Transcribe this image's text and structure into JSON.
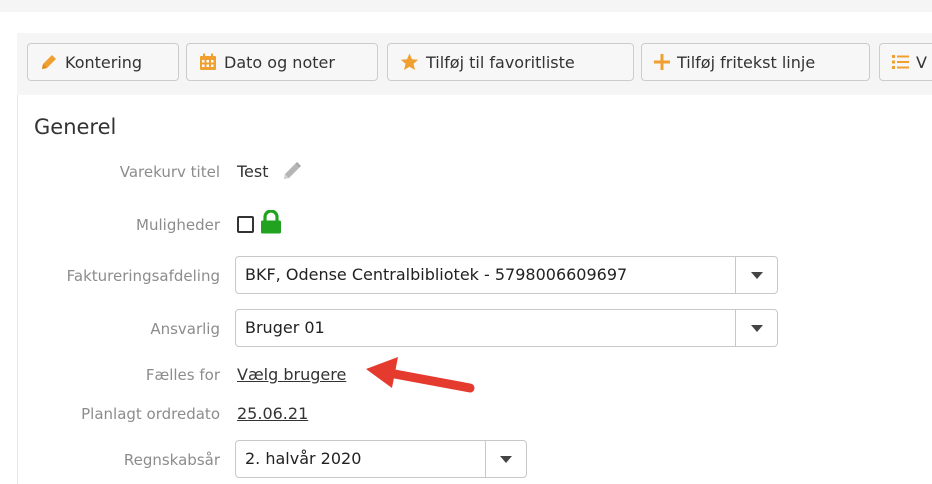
{
  "toolbar": {
    "kontering": "Kontering",
    "dato_noter": "Dato og noter",
    "favoritliste": "Tilføj til favoritliste",
    "fritekst": "Tilføj fritekst linje",
    "truncated": "V"
  },
  "section": {
    "title": "Generel",
    "varekurv_label": "Varekurv titel",
    "varekurv_value": "Test",
    "muligheder_label": "Muligheder",
    "fakturering_label": "Faktureringsafdeling",
    "fakturering_value": "BKF, Odense Centralbibliotek - 5798006609697",
    "ansvarlig_label": "Ansvarlig",
    "ansvarlig_value": "Bruger 01",
    "faelles_label": "Fælles for",
    "faelles_link": "Vælg brugere",
    "planlagt_label": "Planlagt ordredato",
    "planlagt_value": "25.06.21",
    "regnskab_label": "Regnskabsår",
    "regnskab_value": "2. halvår 2020"
  },
  "colors": {
    "pencil": "#f0a030",
    "calendar": "#f0a030",
    "star": "#f0a030",
    "plus": "#f0a030",
    "list": "#f0a030",
    "lock": "#21a321",
    "arrow": "#e53a2e"
  },
  "icons": [
    "pencil-icon",
    "calendar-icon",
    "star-icon",
    "plus-icon",
    "list-icon",
    "edit-pencil-icon",
    "lock-icon",
    "chevron-down-icon",
    "annotation-arrow"
  ]
}
